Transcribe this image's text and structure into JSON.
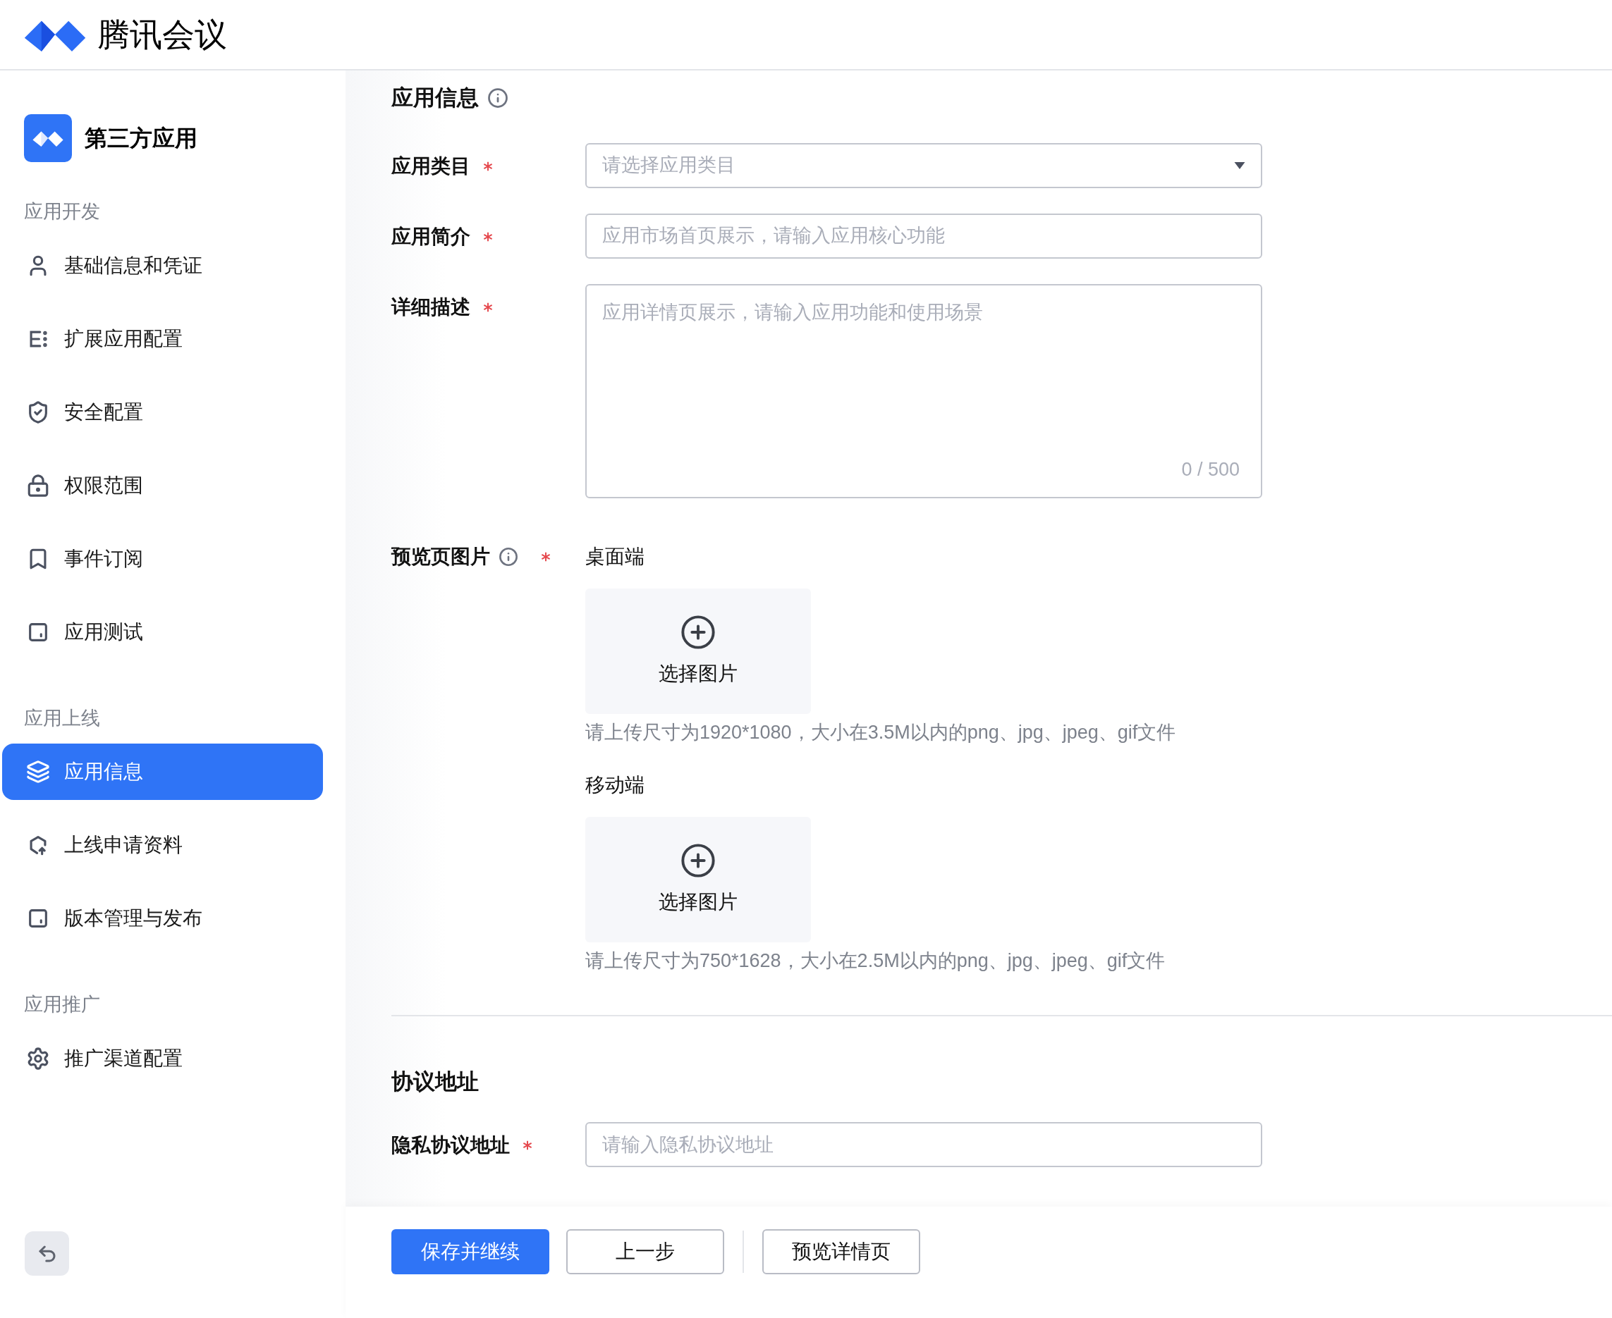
{
  "header": {
    "title": "腾讯会议"
  },
  "sidebar": {
    "app_name": "第三方应用",
    "sections": [
      {
        "title": "应用开发",
        "items": [
          {
            "label": "基础信息和凭证",
            "kind": "user",
            "selected": false
          },
          {
            "label": "扩展应用配置",
            "kind": "list",
            "selected": false
          },
          {
            "label": "安全配置",
            "kind": "shield",
            "selected": false
          },
          {
            "label": "权限范围",
            "kind": "lock",
            "selected": false
          },
          {
            "label": "事件订阅",
            "kind": "bookmark",
            "selected": false
          },
          {
            "label": "应用测试",
            "kind": "square",
            "selected": false
          }
        ]
      },
      {
        "title": "应用上线",
        "items": [
          {
            "label": "应用信息",
            "kind": "layers",
            "selected": true
          },
          {
            "label": "上线申请资料",
            "kind": "upload",
            "selected": false
          },
          {
            "label": "版本管理与发布",
            "kind": "square",
            "selected": false
          }
        ]
      },
      {
        "title": "应用推广",
        "items": [
          {
            "label": "推广渠道配置",
            "kind": "gear",
            "selected": false
          }
        ]
      }
    ]
  },
  "form": {
    "title": "应用信息",
    "fields": [
      {
        "label": "应用类目",
        "required": true,
        "kind": "select",
        "placeholder": "请选择应用类目"
      },
      {
        "label": "应用简介",
        "required": true,
        "kind": "input",
        "placeholder": "应用市场首页展示，请输入应用核心功能"
      },
      {
        "label": "详细描述",
        "required": true,
        "kind": "textarea",
        "placeholder": "应用详情页展示，请输入应用功能和使用场景",
        "counter": "0 / 500"
      }
    ],
    "preview": {
      "label": "预览页图片",
      "required": true,
      "groups": [
        {
          "title": "桌面端",
          "button": "选择图片",
          "hint": "请上传尺寸为1920*1080，大小在3.5M以内的png、jpg、jpeg、gif文件"
        },
        {
          "title": "移动端",
          "button": "选择图片",
          "hint": "请上传尺寸为750*1628，大小在2.5M以内的png、jpg、jpeg、gif文件"
        }
      ]
    }
  },
  "agreement": {
    "title": "协议地址",
    "fields": [
      {
        "label": "隐私协议地址",
        "required": true,
        "kind": "input",
        "placeholder": "请输入隐私协议地址"
      }
    ]
  },
  "footer": {
    "buttons": [
      {
        "label": "保存并继续",
        "kind": "primary"
      },
      {
        "label": "上一步",
        "kind": "default"
      },
      {
        "label": "预览详情页",
        "kind": "default"
      }
    ]
  }
}
